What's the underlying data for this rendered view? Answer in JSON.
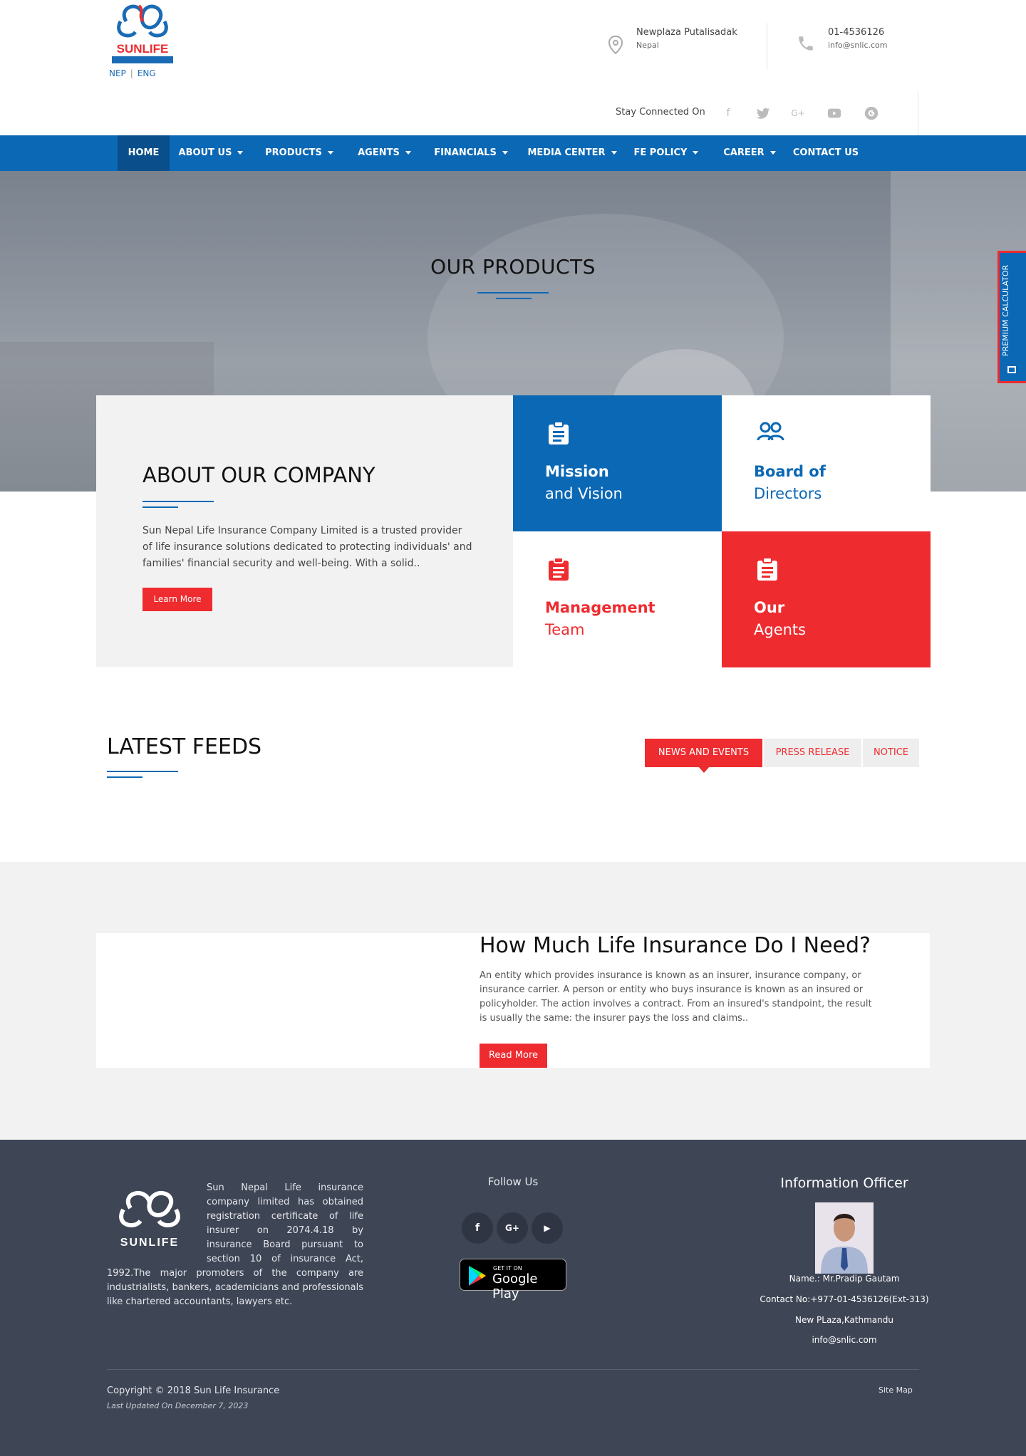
{
  "header": {
    "logo_text": "SUNLIFE",
    "lang_nep": "NEP",
    "lang_sep": "|",
    "lang_eng": "ENG",
    "address_line1": "Newplaza Putalisadak",
    "address_line2": "Nepal",
    "phone": "01-4536126",
    "email": "info@snlic.com",
    "stay_connected": "Stay Connected On",
    "social_icons": [
      "facebook-icon",
      "twitter-icon",
      "google-plus-icon",
      "youtube-icon",
      "google-icon"
    ]
  },
  "nav": {
    "items": [
      {
        "label": "HOME",
        "caret": false
      },
      {
        "label": "ABOUT US",
        "caret": true
      },
      {
        "label": "PRODUCTS",
        "caret": true
      },
      {
        "label": "AGENTS",
        "caret": true
      },
      {
        "label": "FINANCIALS",
        "caret": true
      },
      {
        "label": "MEDIA CENTER",
        "caret": true
      },
      {
        "label": "FE POLICY",
        "caret": true
      },
      {
        "label": "CAREER",
        "caret": true
      },
      {
        "label": "CONTACT US",
        "caret": false
      }
    ]
  },
  "hero": {
    "title": "OUR PRODUCTS"
  },
  "premium_calculator": {
    "label": "PREMIUM CALCULATOR"
  },
  "about": {
    "title": "ABOUT OUR COMPANY",
    "text": "Sun Nepal Life Insurance Company Limited is a trusted provider of life insurance solutions dedicated to protecting individuals' and families' financial security and well-being. With a solid..",
    "button": "Learn More"
  },
  "tiles": [
    {
      "line1": "Mission",
      "line2": "and Vision"
    },
    {
      "line1": "Board of",
      "line2": "Directors"
    },
    {
      "line1": "Management",
      "line2": "Team"
    },
    {
      "line1": "Our",
      "line2": "Agents"
    }
  ],
  "feeds": {
    "title": "LATEST FEEDS",
    "tabs": [
      "NEWS AND EVENTS",
      "PRESS RELEASE",
      "NOTICE"
    ]
  },
  "insurance": {
    "title": "How Much Life Insurance Do I Need?",
    "text": "An entity which provides insurance is known as an insurer, insurance company, or insurance carrier. A person or entity who buys insurance is known as an insured or policyholder. The action involves a contract. From an insured's standpoint, the result is usually the same: the insurer pays the loss and claims..",
    "button": "Read More"
  },
  "footer": {
    "logo_text": "SUNLIFE",
    "about_text": "Sun Nepal Life insurance company limited has obtained registration certificate of life insurer on 2074.4.18 by insurance Board pursuant to section 10 of insurance Act, 1992.The major promoters of the company are industrialists, bankers, academicians and professionals like chartered accountants, lawyers etc.",
    "follow_us": "Follow Us",
    "social": [
      "f",
      "G+",
      "▶"
    ],
    "gplay_small": "GET IT ON",
    "gplay_big": "Google Play",
    "info_title": "Information Officer",
    "info_name": "Name.: Mr.Pradip Gautam",
    "info_contact": "Contact No:+977-01-4536126(Ext-313)",
    "info_address": "New PLaza,Kathmandu",
    "info_email": "info@snlic.com",
    "copyright": "Copyright © 2018 Sun Life Insurance",
    "updated": "Last Updated On December 7, 2023",
    "sitemap": "Site Map"
  },
  "colors": {
    "brand_blue": "#0b68b5",
    "brand_red": "#ee2b2f",
    "footer_bg": "#3e4555"
  }
}
